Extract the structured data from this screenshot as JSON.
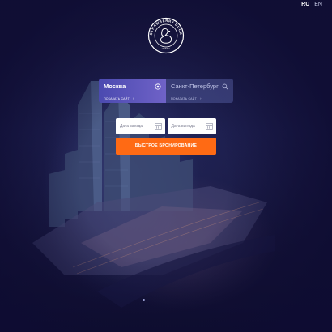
{
  "languages": {
    "ru": "RU",
    "en": "EN"
  },
  "logo": {
    "text_ring": "STRAWBERRY DUCK",
    "text_bottom": "HOSTEL"
  },
  "city_from": {
    "name": "Москва",
    "link": "ПОКАЗАТЬ САЙТ",
    "link_arrow": "›"
  },
  "city_to": {
    "name": "Санкт-Петербург",
    "link": "ПОКАЗАТЬ САЙТ",
    "link_arrow": "›"
  },
  "check_in": {
    "placeholder": "Дата заезда"
  },
  "check_out": {
    "placeholder": "Дата выезда"
  },
  "booking_button": "БЫСТРОЕ БРОНИРОВАНИЕ",
  "colors": {
    "accent": "#ff6a14",
    "active_city": "#5a52bb",
    "background": "#15143a"
  }
}
